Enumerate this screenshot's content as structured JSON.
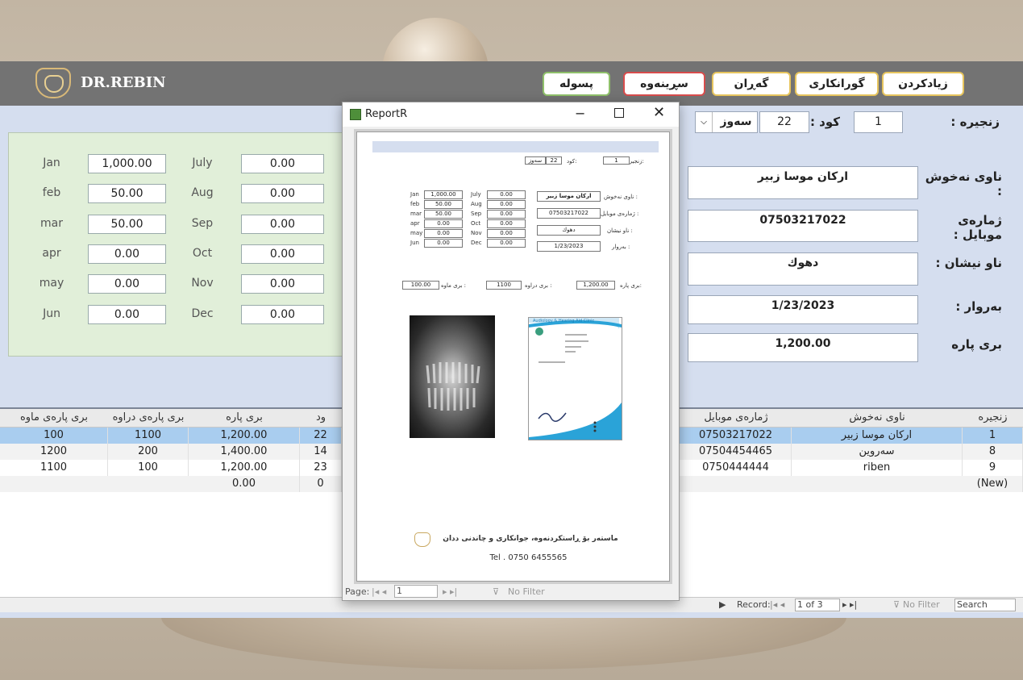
{
  "header": {
    "brand": "DR.REBIN",
    "nav": [
      {
        "label": "زیادکردن"
      },
      {
        "label": "گورانکاری"
      },
      {
        "label": "گەڕان"
      },
      {
        "label": "سڕینەوە"
      },
      {
        "label": "پسوله"
      }
    ]
  },
  "form": {
    "chain_label": "زنجیره :",
    "chain_value": "1",
    "code_label": "کود :",
    "code_value": "22",
    "color_value": "سەوز",
    "name_label": "ناوی نەخوش :",
    "name_value": "اركان موسا زبير",
    "mobile_label": "ژمارەی موبایل :",
    "mobile_value": "07503217022",
    "address_label": "ناو نیشان :",
    "address_value": "دهوك",
    "date_label": "بەروار :",
    "date_value": "1/23/2023",
    "amount_label": "بری پارە",
    "amount_value": "1,200.00"
  },
  "months": [
    {
      "name": "Jan",
      "value": "1,000.00"
    },
    {
      "name": "feb",
      "value": "50.00"
    },
    {
      "name": "mar",
      "value": "50.00"
    },
    {
      "name": "apr",
      "value": "0.00"
    },
    {
      "name": "may",
      "value": "0.00"
    },
    {
      "name": "Jun",
      "value": "0.00"
    },
    {
      "name": "July",
      "value": "0.00"
    },
    {
      "name": "Aug",
      "value": "0.00"
    },
    {
      "name": "Sep",
      "value": "0.00"
    },
    {
      "name": "Oct",
      "value": "0.00"
    },
    {
      "name": "Nov",
      "value": "0.00"
    },
    {
      "name": "Dec",
      "value": "0.00"
    }
  ],
  "table": {
    "headers": {
      "remaining": "بری پارەی ماوە",
      "paid": "بری پارەی دراوە",
      "amount": "بری پارە",
      "code": "ود",
      "mobile": "ژمارەی موبایل",
      "name": "ناوی نەخوش",
      "chain": "زنجیرە"
    },
    "rows": [
      {
        "remaining": "100",
        "paid": "1100",
        "amount": "1,200.00",
        "code": "22",
        "mobile": "07503217022",
        "name": "اركان موسا زبير",
        "chain": "1"
      },
      {
        "remaining": "1200",
        "paid": "200",
        "amount": "1,400.00",
        "code": "14",
        "mobile": "07504454465",
        "name": "سەروین",
        "chain": "8"
      },
      {
        "remaining": "1100",
        "paid": "100",
        "amount": "1,200.00",
        "code": "23",
        "mobile": "0750444444",
        "name": "riben",
        "chain": "9"
      },
      {
        "remaining": "",
        "paid": "",
        "amount": "0.00",
        "code": "0",
        "mobile": "",
        "name": "",
        "chain": "(New)"
      }
    ],
    "record_label": "Record:",
    "record_value": "1 of 3",
    "filter_label": "No Filter",
    "search_label": "Search"
  },
  "report": {
    "title": "ReportR",
    "chain_label": "زنجیره:",
    "chain_value": "1",
    "code_label": "کود:",
    "code_value": "22",
    "color_value": "سەوز",
    "name_label": "ناوی نەخوش :",
    "name_value": "اركان موسا زبير",
    "mobile_label": "ژمارەی موبایل :",
    "mobile_value": "07503217022",
    "address_label": "ناو نیشان :",
    "address_value": "دهوك",
    "date_label": "بەروار :",
    "date_value": "1/23/2023",
    "amount_label": "بری پارە:",
    "amount_value": "1,200.00",
    "paid_label": "بری دراوە :",
    "paid_value": "1100",
    "remaining_label": "بری ماوە :",
    "remaining_value": "100.00",
    "months": [
      {
        "name": "Jan",
        "value": "1,000.00"
      },
      {
        "name": "feb",
        "value": "50.00"
      },
      {
        "name": "mar",
        "value": "50.00"
      },
      {
        "name": "apr",
        "value": "0.00"
      },
      {
        "name": "may",
        "value": "0.00"
      },
      {
        "name": "Jun",
        "value": "0.00"
      },
      {
        "name": "July",
        "value": "0.00"
      },
      {
        "name": "Aug",
        "value": "0.00"
      },
      {
        "name": "Sep",
        "value": "0.00"
      },
      {
        "name": "Oct",
        "value": "0.00"
      },
      {
        "name": "Nov",
        "value": "0.00"
      },
      {
        "name": "Dec",
        "value": "0.00"
      }
    ],
    "letter_header": "Audiology & Hearing Aid Clinic",
    "footer_line1": "ماستەر بۆ ڕاستکردنەوە، جوانکاری و چاندنی ددان",
    "footer_line2": "Tel . 0750 6455565",
    "page_label": "Page:",
    "page_value": "1",
    "filter_label": "No Filter"
  },
  "colors": {
    "topbar": "#737373",
    "selected_row": "#a9cdef",
    "nav_border": "#e6c45d",
    "delete_border": "#d84c4c",
    "receipt_border": "#8fc06a"
  }
}
